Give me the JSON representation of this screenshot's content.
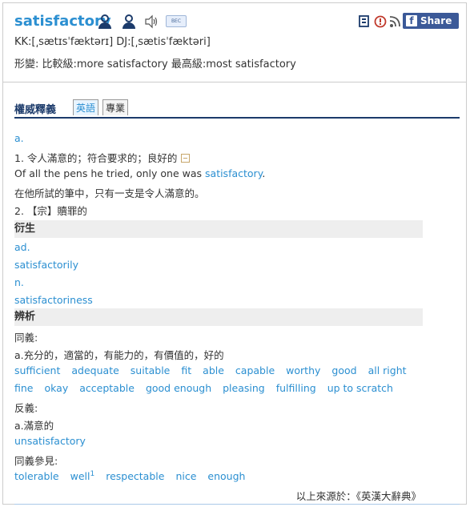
{
  "entry": {
    "word": "satisfactory",
    "pron_kk": "KK:[͵sætɪsˈfæktərɪ] DJ:[͵sætisˈfæktəri]",
    "forms": "形變: 比較級:more satisfactory  最高級:most satisfactory",
    "bec_label": "BEC"
  },
  "toolbar": {
    "share_label": "Share 0",
    "fb_glyph": "f"
  },
  "tabs": {
    "main": "權威釋義",
    "items": [
      "英語",
      "專業"
    ]
  },
  "definitions": {
    "pos": "a.",
    "def1": "1. 令人滿意的；符合要求的；良好的",
    "example_pre": "Of all the pens he tried, only one was ",
    "example_word": "satisfactory",
    "example_post": ".",
    "example_zh": "在他所試的筆中，只有一支是令人滿意的。",
    "def2": "2. 【宗】贖罪的"
  },
  "derivatives": {
    "title": "衍生",
    "items": [
      {
        "pos": "ad.",
        "word": "satisfactorily"
      },
      {
        "pos": "n.",
        "word": "satisfactoriness"
      }
    ]
  },
  "analysis": {
    "title": "辨析",
    "syn_label": "同義:",
    "syn_def": "a.充分的，適當的，有能力的，有價值的，好的",
    "syn_row1": [
      "sufficient",
      "adequate",
      "suitable",
      "fit",
      "able",
      "capable",
      "worthy",
      "good",
      "all right"
    ],
    "syn_row2": [
      "fine",
      "okay",
      "acceptable",
      "good enough",
      "pleasing",
      "fulfilling",
      "up to scratch"
    ],
    "ant_label": "反義:",
    "ant_def": "a.滿意的",
    "ant_word": "unsatisfactory",
    "see_label": "同義參見:",
    "see_row": [
      "tolerable",
      "well",
      "respectable",
      "nice",
      "enough"
    ],
    "see_sup": "1"
  },
  "source": "以上來源於：《英漢大辭典》"
}
